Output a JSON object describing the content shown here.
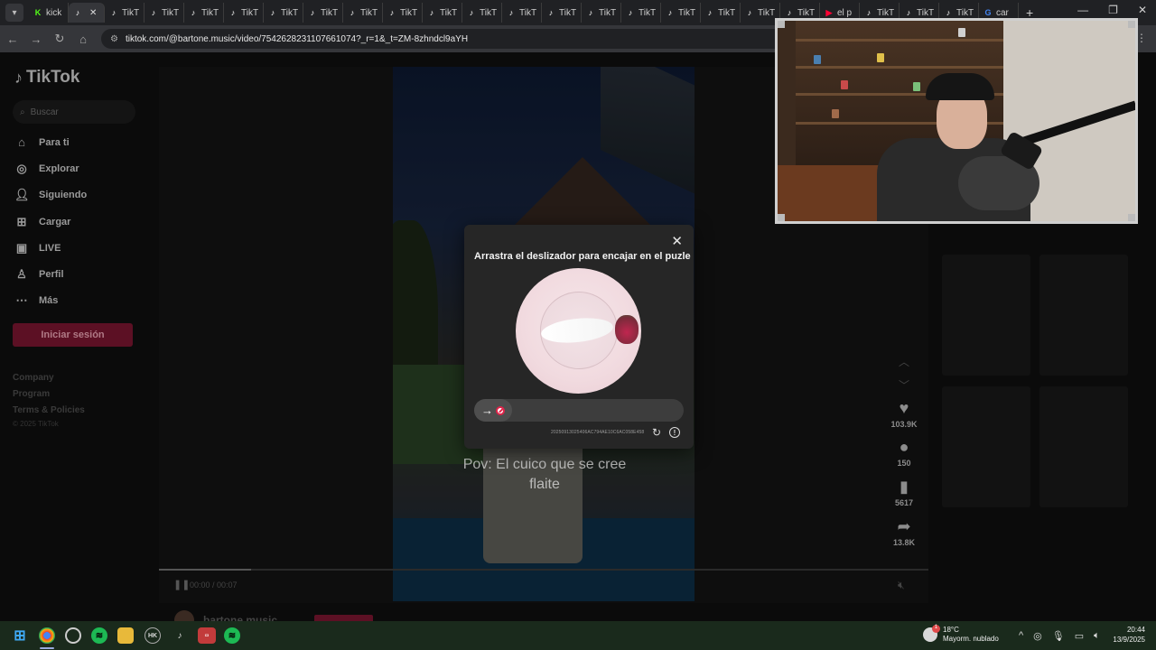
{
  "browser": {
    "tabs": [
      {
        "label": "kick",
        "icon": "kick-icon"
      },
      {
        "label": "",
        "icon": "tiktok-icon",
        "active": true
      },
      {
        "label": "TikT",
        "icon": "tiktok-icon"
      },
      {
        "label": "TikT",
        "icon": "tiktok-icon"
      },
      {
        "label": "TikT",
        "icon": "tiktok-icon"
      },
      {
        "label": "TikT",
        "icon": "tiktok-icon"
      },
      {
        "label": "TikT",
        "icon": "tiktok-icon"
      },
      {
        "label": "TikT",
        "icon": "tiktok-icon"
      },
      {
        "label": "TikT",
        "icon": "tiktok-icon"
      },
      {
        "label": "TikT",
        "icon": "tiktok-icon"
      },
      {
        "label": "TikT",
        "icon": "tiktok-icon"
      },
      {
        "label": "TikT",
        "icon": "tiktok-icon"
      },
      {
        "label": "TikT",
        "icon": "tiktok-icon"
      },
      {
        "label": "TikT",
        "icon": "tiktok-icon"
      },
      {
        "label": "TikT",
        "icon": "tiktok-icon"
      },
      {
        "label": "TikT",
        "icon": "tiktok-icon"
      },
      {
        "label": "TikT",
        "icon": "tiktok-icon"
      },
      {
        "label": "TikT",
        "icon": "tiktok-icon"
      },
      {
        "label": "TikT",
        "icon": "tiktok-icon"
      },
      {
        "label": "TikT",
        "icon": "tiktok-icon"
      },
      {
        "label": "el p",
        "icon": "youtube-icon"
      },
      {
        "label": "TikT",
        "icon": "tiktok-icon"
      },
      {
        "label": "TikT",
        "icon": "tiktok-icon"
      },
      {
        "label": "TikT",
        "icon": "tiktok-icon"
      },
      {
        "label": "car",
        "icon": "google-icon"
      }
    ],
    "url": "tiktok.com/@bartone.music/video/7542628231107661074?_r=1&_t=ZM-8zhndcl9aYH"
  },
  "tiktok": {
    "logo": "TikTok",
    "search_placeholder": "Buscar",
    "nav": [
      {
        "label": "Para ti",
        "icon": "home-icon"
      },
      {
        "label": "Explorar",
        "icon": "compass-icon"
      },
      {
        "label": "Siguiendo",
        "icon": "following-icon"
      },
      {
        "label": "Cargar",
        "icon": "upload-icon"
      },
      {
        "label": "LIVE",
        "icon": "live-icon"
      },
      {
        "label": "Perfil",
        "icon": "profile-icon"
      },
      {
        "label": "Más",
        "icon": "more-icon"
      }
    ],
    "login_button": "Iniciar sesión",
    "footer_links": [
      "Company",
      "Program",
      "Terms & Policies"
    ],
    "copyright": "© 2025 TikTok",
    "video": {
      "caption_line1": "Pov: El cuico que se cree",
      "caption_line2": "flaite",
      "time": "00:00 / 00:07",
      "progress_fraction": 0.12,
      "author": "bartone.music"
    },
    "actions": {
      "likes": "103.9K",
      "comments": "150",
      "saves": "5617",
      "shares": "13.8K"
    }
  },
  "captcha": {
    "title": "Arrastra el deslizador para encajar en el puzle",
    "code": "20250913025406AC794AE10C6AC058E458",
    "slider_position": 0,
    "handle_icon": "arrow-right-icon"
  },
  "taskbar": {
    "weather_temp": "18°C",
    "weather_desc": "Mayorm. nublado",
    "weather_badge": "1",
    "time": "20:44",
    "date": "13/9/2025"
  }
}
